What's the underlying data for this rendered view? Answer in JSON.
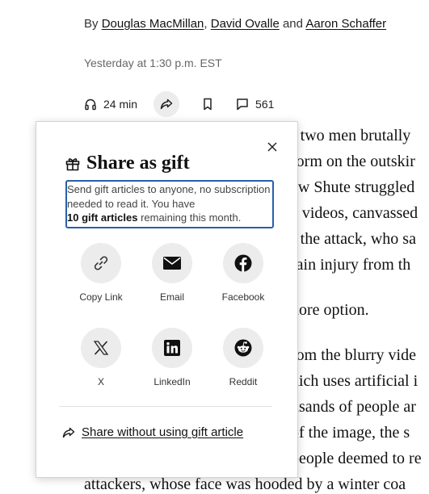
{
  "byline": {
    "prefix": "By",
    "author1": "Douglas MacMillan",
    "sep1": ",",
    "author2": "David Ovalle",
    "sep2": "and",
    "author3": "Aaron Schaffer"
  },
  "timestamp": "Yesterday at 1:30 p.m. EST",
  "toolbar": {
    "listen_icon": "headphones-icon",
    "listen_label": "24 min",
    "share_icon": "share-icon",
    "bookmark_icon": "bookmark-icon",
    "comments_icon": "comment-icon",
    "comments_count": "561"
  },
  "article_lines": [
    "r two men brutally",
    "form on the outskir",
    "ew Shute struggled",
    "e videos, canvassed",
    "f the attack, who sa",
    "rain injury from th",
    "nore option.",
    "rom the blurry vide",
    "hich uses artificial i",
    "usands of people ar",
    "of the image, the s",
    "people deemed to re",
    "attackers, whose face was hooded by a winter coa"
  ],
  "popover": {
    "title": "Share as gift",
    "title_icon": "gift-icon",
    "info_text": "Send gift articles to anyone, no subscription needed to read it. You have",
    "info_bold": "10 gift articles",
    "info_suffix": "remaining this month.",
    "close_icon": "close-icon",
    "options": [
      {
        "label": "Copy Link",
        "icon": "link-icon"
      },
      {
        "label": "Email",
        "icon": "email-icon"
      },
      {
        "label": "Facebook",
        "icon": "facebook-icon"
      },
      {
        "label": "X",
        "icon": "x-icon"
      },
      {
        "label": "LinkedIn",
        "icon": "linkedin-icon"
      },
      {
        "label": "Reddit",
        "icon": "reddit-icon"
      }
    ],
    "share_without_label": "Share without using gift article",
    "share_without_icon": "share-icon"
  }
}
